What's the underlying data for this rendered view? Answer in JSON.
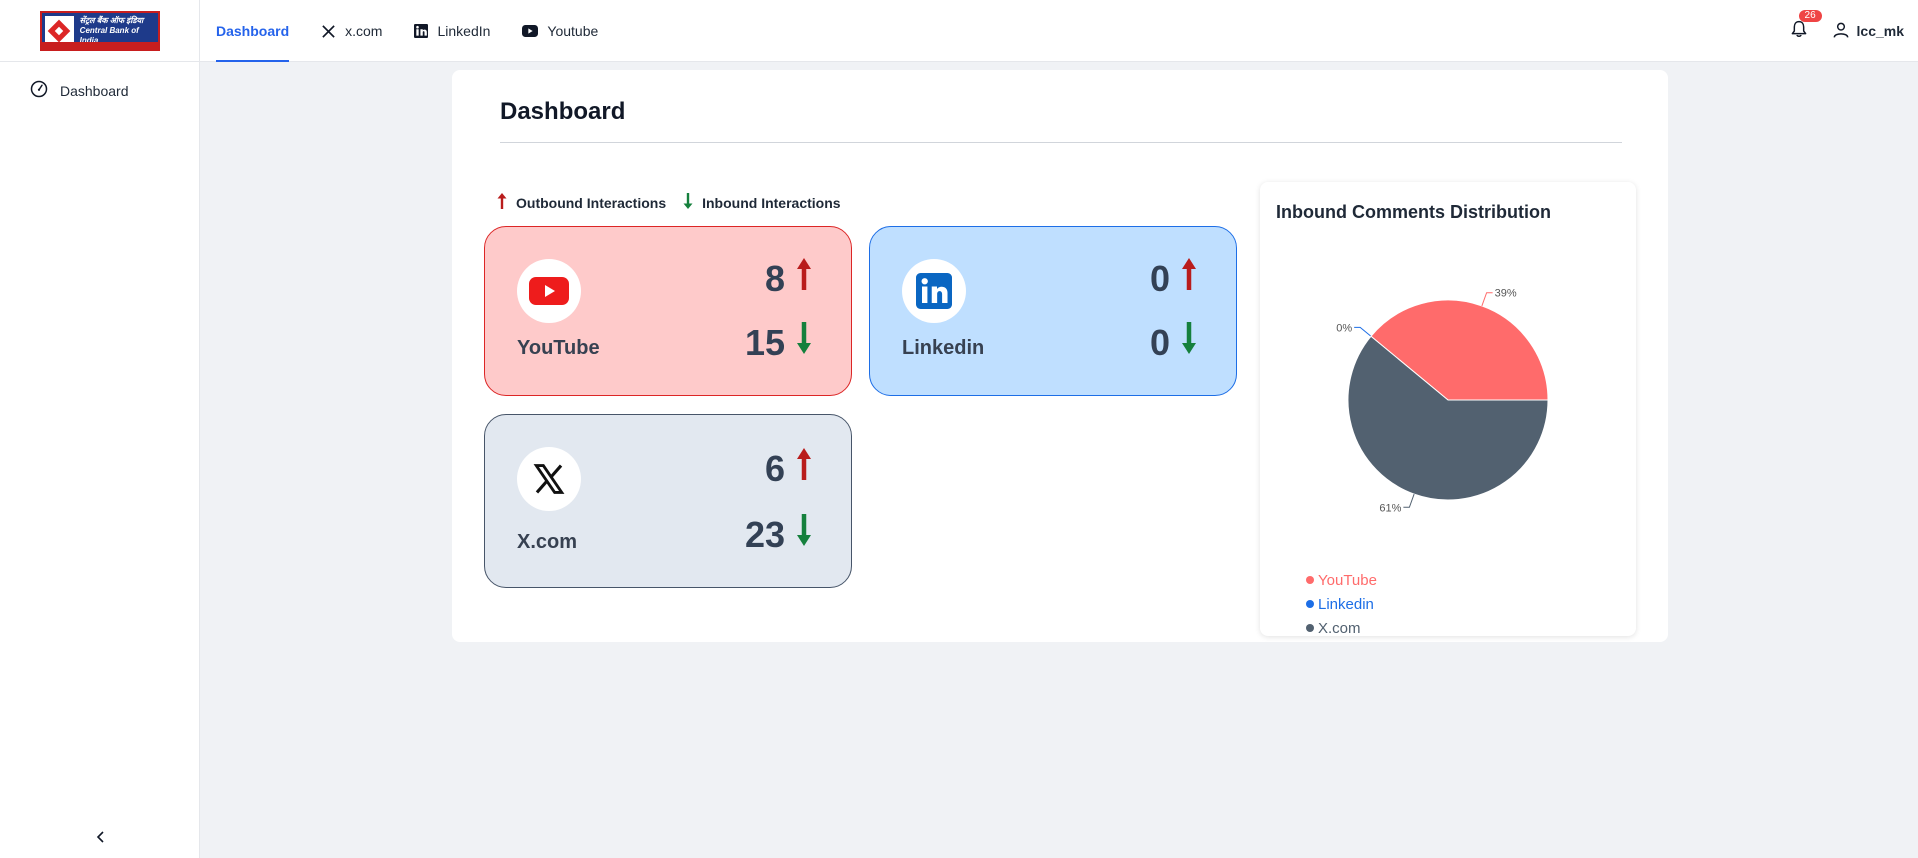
{
  "header": {
    "logo_alt": "Central Bank of India",
    "nav": [
      {
        "label": "Dashboard",
        "icon": "none",
        "active": true
      },
      {
        "label": "x.com",
        "icon": "x-logo-icon"
      },
      {
        "label": "LinkedIn",
        "icon": "linkedin-icon"
      },
      {
        "label": "Youtube",
        "icon": "youtube-icon"
      }
    ],
    "notification_count": "26",
    "username": "lcc_mk"
  },
  "sidebar": {
    "items": [
      {
        "label": "Dashboard",
        "icon": "gauge-icon"
      }
    ],
    "collapse_icon": "chevron-left-icon"
  },
  "main": {
    "title": "Dashboard",
    "legend": {
      "outbound": "Outbound Interactions",
      "inbound": "Inbound Interactions",
      "outbound_color": "#b91c1c",
      "inbound_color": "#15803d"
    },
    "cards": [
      {
        "name": "YouTube",
        "outbound": "8",
        "inbound": "15",
        "icon": "youtube-icon"
      },
      {
        "name": "Linkedin",
        "outbound": "0",
        "inbound": "0",
        "icon": "linkedin-icon"
      },
      {
        "name": "X.com",
        "outbound": "6",
        "inbound": "23",
        "icon": "x-logo-icon"
      }
    ]
  },
  "pie": {
    "title": "Inbound Comments Distribution",
    "legend": [
      {
        "label": "YouTube",
        "color": "#ff6b6b"
      },
      {
        "label": "Linkedin",
        "color": "#1d6ee6"
      },
      {
        "label": "X.com",
        "color": "#526170"
      }
    ]
  },
  "chart_data": {
    "type": "pie",
    "title": "Inbound Comments Distribution",
    "categories": [
      "YouTube",
      "Linkedin",
      "X.com"
    ],
    "values": [
      39,
      0,
      61
    ],
    "labels": [
      "39%",
      "0%",
      "61%"
    ],
    "colors": [
      "#ff6b6b",
      "#1d6ee6",
      "#526170"
    ],
    "legend_position": "bottom-left"
  }
}
